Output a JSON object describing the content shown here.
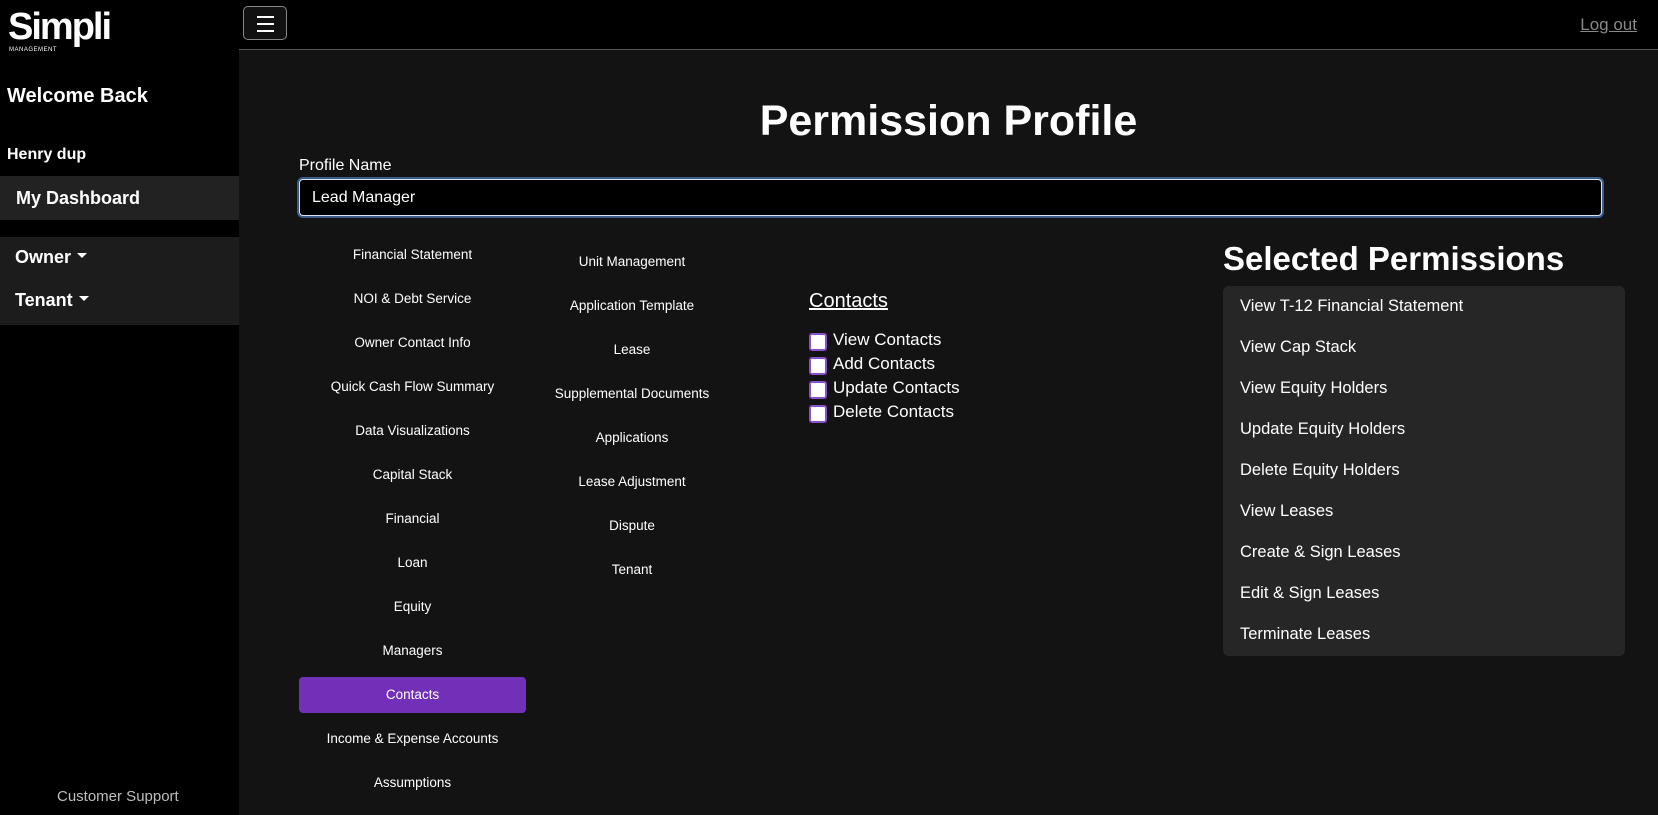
{
  "sidebar": {
    "logo_text": "Simpli",
    "logo_sub": "MANAGEMENT",
    "welcome": "Welcome Back",
    "username": "Henry dup",
    "dashboard": "My Dashboard",
    "menus": [
      "Owner",
      "Tenant"
    ],
    "support": "Customer Support"
  },
  "topbar": {
    "logout": "Log out"
  },
  "page": {
    "title": "Permission Profile",
    "profile_name_label": "Profile Name",
    "profile_name_value": "Lead Manager"
  },
  "categories_col1": [
    "Financial Statement",
    "NOI & Debt Service",
    "Owner Contact Info",
    "Quick Cash Flow Summary",
    "Data Visualizations",
    "Capital Stack",
    "Financial",
    "Loan",
    "Equity",
    "Managers",
    "Contacts",
    "Income & Expense Accounts",
    "Assumptions"
  ],
  "active_category": "Contacts",
  "categories_col2": [
    "Unit Management",
    "Application Template",
    "Lease",
    "Supplemental Documents",
    "Applications",
    "Lease Adjustment",
    "Dispute",
    "Tenant"
  ],
  "contacts_section": {
    "title": "Contacts",
    "options": [
      "View Contacts",
      "Add Contacts",
      "Update Contacts",
      "Delete Contacts"
    ]
  },
  "selected": {
    "title": "Selected Permissions",
    "items": [
      "View T-12 Financial Statement",
      "View Cap Stack",
      "View Equity Holders",
      "Update Equity Holders",
      "Delete Equity Holders",
      "View Leases",
      "Create & Sign Leases",
      "Edit & Sign Leases",
      "Terminate Leases"
    ]
  },
  "colors": {
    "accent": "#7230b8",
    "checkbox_border": "#8a4fd0"
  }
}
